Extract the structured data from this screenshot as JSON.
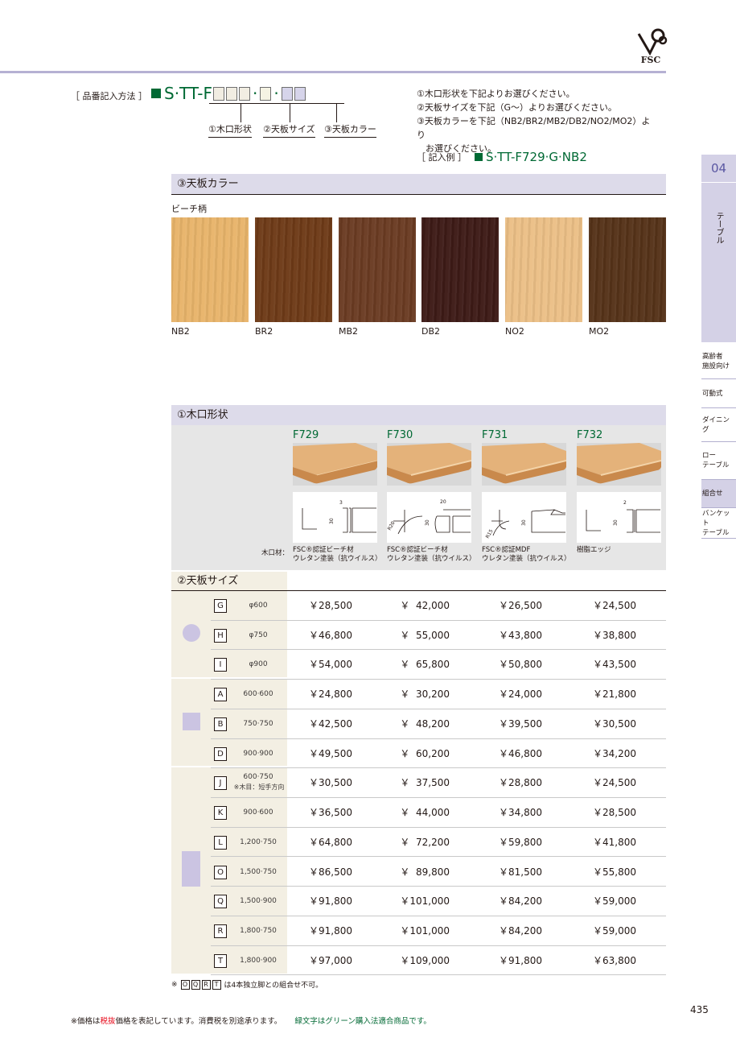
{
  "header": {
    "logo_text": "FSC",
    "howto_label": "［ 品番記入方法 ］",
    "code_prefix": "S·TT-F",
    "parts": [
      "①木口形状",
      "②天板サイズ",
      "③天板カラー"
    ],
    "instructions": [
      "①木口形状を下記よりお選びください。",
      "②天板サイズを下記（G～）よりお選びください。",
      "③天板カラーを下記（NB2/BR2/MB2/DB2/NO2/MO2）より",
      "　お選びください。"
    ],
    "example_label": "［ 記入例 ］",
    "example_code": "S·TT-F729·G·NB2"
  },
  "sidebar": {
    "number": "04",
    "category": "テーブル",
    "items": [
      "高齢者\n施設向け",
      "可動式",
      "ダイニング",
      "ロー\nテーブル",
      "組合せ",
      "バンケット\nテーブル"
    ],
    "active_index": 4
  },
  "color_section": {
    "title": "③天板カラー",
    "subtitle": "ビーチ柄",
    "swatches": [
      {
        "code": "NB2",
        "color": "#e8b46a"
      },
      {
        "code": "BR2",
        "color": "#6e3a17"
      },
      {
        "code": "MB2",
        "color": "#6a3b22"
      },
      {
        "code": "DB2",
        "color": "#3d1a16"
      },
      {
        "code": "NO2",
        "color": "#ebbf86"
      },
      {
        "code": "MO2",
        "color": "#553218"
      }
    ]
  },
  "edge_section": {
    "title": "①木口形状",
    "material_label": "木口材：",
    "edges": [
      {
        "code": "F729",
        "material": [
          "FSC®認証ビーチ材",
          "ウレタン塗装（抗ウイルス）"
        ],
        "dims": [
          "3",
          "30"
        ]
      },
      {
        "code": "F730",
        "material": [
          "FSC®認証ビーチ材",
          "ウレタン塗装（抗ウイルス）"
        ],
        "dims": [
          "R20",
          "20",
          "30"
        ]
      },
      {
        "code": "F731",
        "material": [
          "FSC®認証MDF",
          "ウレタン塗装（抗ウイルス）"
        ],
        "dims": [
          "R15",
          "30"
        ]
      },
      {
        "code": "F732",
        "material": [
          "樹脂エッジ"
        ],
        "dims": [
          "2",
          "30"
        ]
      }
    ]
  },
  "size_section": {
    "title": "②天板サイズ",
    "rows": [
      {
        "code": "G",
        "size": "φ600",
        "note": "",
        "prices": [
          "￥28,500",
          "￥  42,000",
          "￥26,500",
          "￥24,500"
        ]
      },
      {
        "code": "H",
        "size": "φ750",
        "note": "",
        "prices": [
          "￥46,800",
          "￥  55,000",
          "￥43,800",
          "￥38,800"
        ]
      },
      {
        "code": "I",
        "size": "φ900",
        "note": "",
        "prices": [
          "￥54,000",
          "￥  65,800",
          "￥50,800",
          "￥43,500"
        ]
      },
      {
        "code": "A",
        "size": "600·600",
        "note": "",
        "prices": [
          "￥24,800",
          "￥  30,200",
          "￥24,000",
          "￥21,800"
        ]
      },
      {
        "code": "B",
        "size": "750·750",
        "note": "",
        "prices": [
          "￥42,500",
          "￥  48,200",
          "￥39,500",
          "￥30,500"
        ]
      },
      {
        "code": "D",
        "size": "900·900",
        "note": "",
        "prices": [
          "￥49,500",
          "￥  60,200",
          "￥46,800",
          "￥34,200"
        ]
      },
      {
        "code": "J",
        "size": "600·750",
        "note": "※木目：短手方向",
        "prices": [
          "￥30,500",
          "￥  37,500",
          "￥28,800",
          "￥24,500"
        ]
      },
      {
        "code": "K",
        "size": "900·600",
        "note": "",
        "prices": [
          "￥36,500",
          "￥  44,000",
          "￥34,800",
          "￥28,500"
        ]
      },
      {
        "code": "L",
        "size": "1,200·750",
        "note": "",
        "prices": [
          "￥64,800",
          "￥  72,200",
          "￥59,800",
          "￥41,800"
        ]
      },
      {
        "code": "O",
        "size": "1,500·750",
        "note": "",
        "prices": [
          "￥86,500",
          "￥  89,800",
          "￥81,500",
          "￥55,800"
        ]
      },
      {
        "code": "Q",
        "size": "1,500·900",
        "note": "",
        "prices": [
          "￥91,800",
          "￥101,000",
          "￥84,200",
          "￥59,000"
        ]
      },
      {
        "code": "R",
        "size": "1,800·750",
        "note": "",
        "prices": [
          "￥91,800",
          "￥101,000",
          "￥84,200",
          "￥59,000"
        ]
      },
      {
        "code": "T",
        "size": "1,800·900",
        "note": "",
        "prices": [
          "￥97,000",
          "￥109,000",
          "￥91,800",
          "￥63,800"
        ]
      }
    ],
    "footnote_prefix": "※",
    "footnote_codes": [
      "O",
      "Q",
      "R",
      "T"
    ],
    "footnote_text": "は4本独立脚との組合せ不可。"
  },
  "footer": {
    "page_number": "435",
    "note_a": "※価格は",
    "note_red": "税抜",
    "note_b": "価格を表記しています。消費税を別途承ります。",
    "note_green": "緑文字はグリーン購入法適合商品です。"
  },
  "colors": {
    "green": "#006934",
    "lavender": "#d4d1e6",
    "beige": "#f3efe3"
  }
}
